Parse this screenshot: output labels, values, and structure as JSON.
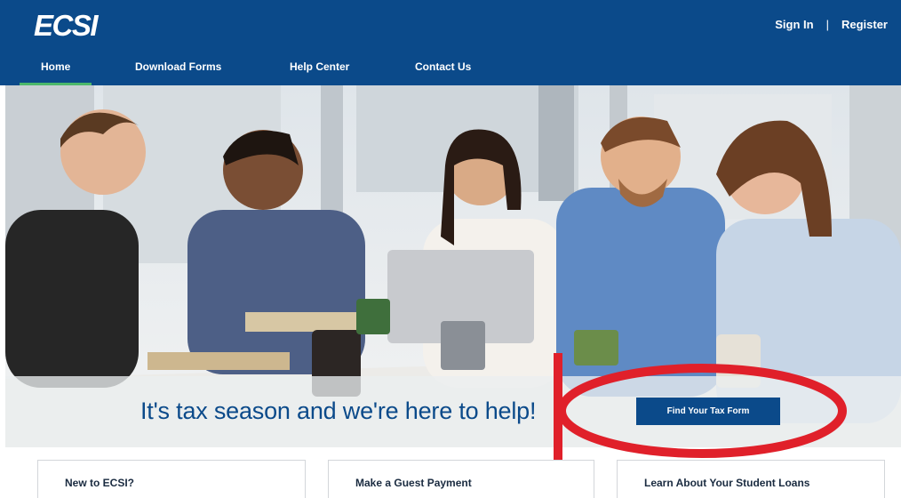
{
  "header": {
    "logo": "ECSI",
    "sign_in": "Sign In",
    "separator": "|",
    "register": "Register"
  },
  "nav": {
    "items": [
      {
        "label": "Home"
      },
      {
        "label": "Download Forms"
      },
      {
        "label": "Help Center"
      },
      {
        "label": "Contact Us"
      }
    ]
  },
  "banner": {
    "text": "It's tax season and we're here to help!",
    "button_label": "Find Your Tax Form"
  },
  "cards": [
    {
      "title": "New to ECSI?"
    },
    {
      "title": "Make a Guest Payment"
    },
    {
      "title": "Learn About Your Student Loans"
    }
  ],
  "colors": {
    "brand": "#0b4a8a",
    "nav_active": "#4cb86b",
    "annotation": "#e0202a"
  }
}
